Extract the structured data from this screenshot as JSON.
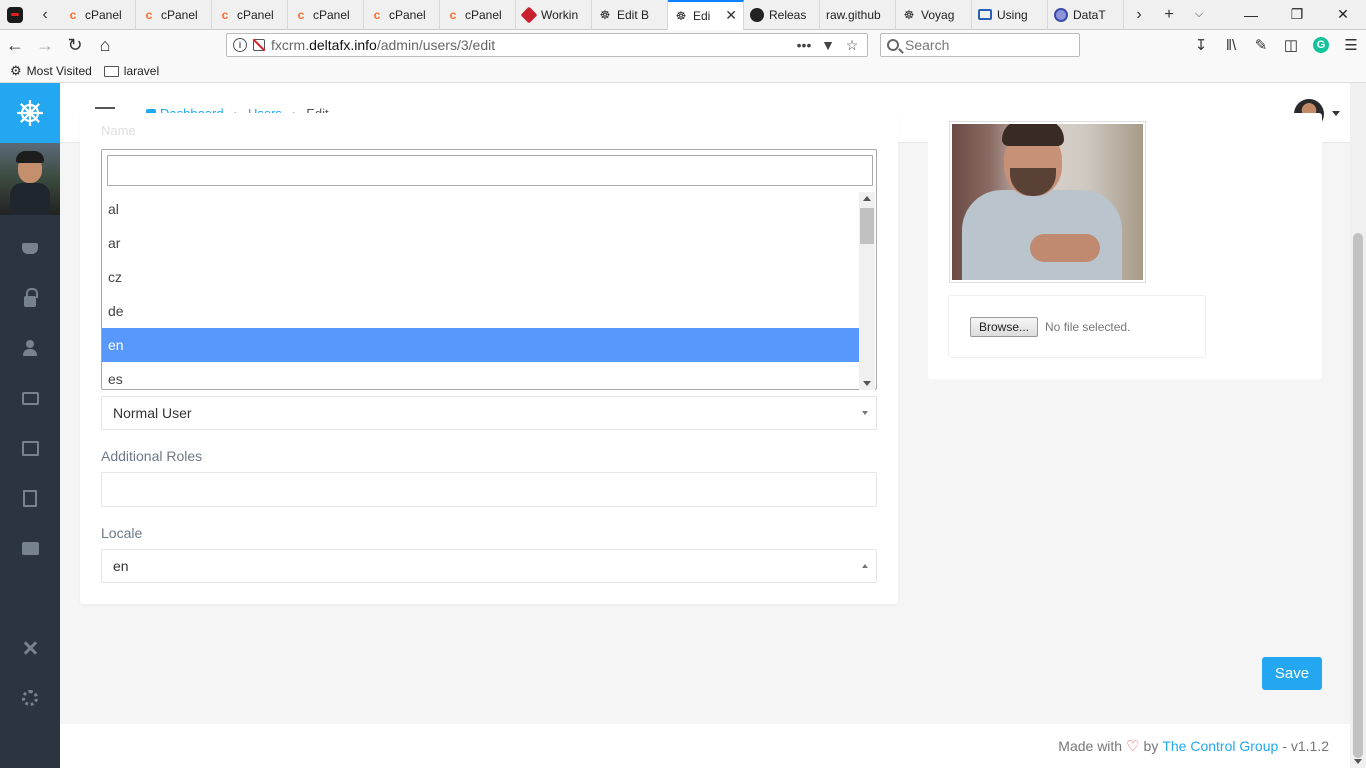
{
  "browser": {
    "tabs": [
      {
        "label": "cPanel",
        "icon": "cpanel-icon"
      },
      {
        "label": "cPanel",
        "icon": "cpanel-icon"
      },
      {
        "label": "cPanel",
        "icon": "cpanel-icon"
      },
      {
        "label": "cPanel",
        "icon": "cpanel-icon"
      },
      {
        "label": "cPanel",
        "icon": "cpanel-icon"
      },
      {
        "label": "cPanel",
        "icon": "cpanel-icon"
      },
      {
        "label": "Workin",
        "icon": "laravel-icon"
      },
      {
        "label": "Edit B",
        "icon": "helm-icon"
      },
      {
        "label": "Edi",
        "icon": "helm-icon",
        "active": true
      },
      {
        "label": "Releas",
        "icon": "github-icon"
      },
      {
        "label": "raw.github",
        "icon": ""
      },
      {
        "label": "Voyag",
        "icon": "helm-icon"
      },
      {
        "label": "Using",
        "icon": "book-icon"
      },
      {
        "label": "DataT",
        "icon": "datatables-icon"
      }
    ],
    "url_prefix": "fxcrm.",
    "url_domain": "deltafx.info",
    "url_path": "/admin/users/3/edit",
    "search_placeholder": "Search",
    "bookmarks": [
      {
        "label": "Most Visited",
        "icon": "gear-icon"
      },
      {
        "label": "laravel",
        "icon": "folder-icon"
      }
    ]
  },
  "breadcrumb": {
    "dashboard": "Dashboard",
    "users": "Users",
    "current": "Edit"
  },
  "form": {
    "name_label": "Name",
    "role_value": "Normal User",
    "additional_roles_label": "Additional Roles",
    "locale_label": "Locale",
    "locale_value": "en",
    "locale_options": [
      "al",
      "ar",
      "cz",
      "de",
      "en",
      "es"
    ],
    "locale_selected": "en"
  },
  "avatar_panel": {
    "browse_label": "Browse...",
    "file_status": "No file selected."
  },
  "actions": {
    "save_label": "Save"
  },
  "footer": {
    "made_with": "Made with",
    "by": "by",
    "company": "The Control Group",
    "version": "- v1.1.2"
  },
  "colors": {
    "accent": "#22a7f0",
    "sidebar": "#2a3541",
    "selected_option": "#5897fb",
    "heart": "#e25555"
  }
}
